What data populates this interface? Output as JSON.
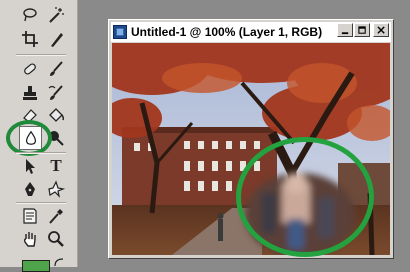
{
  "document": {
    "title": "Untitled-1 @ 100% (Layer 1, RGB)",
    "buttons": {
      "minimize": "minimize",
      "maximize": "maximize",
      "close": "close"
    }
  },
  "toolbox": {
    "tools": [
      "lasso-icon",
      "magic-wand-icon",
      "crop-icon",
      "slice-icon",
      "healing-brush-icon",
      "brush-icon",
      "clone-stamp-icon",
      "history-brush-icon",
      "eraser-icon",
      "paint-bucket-icon",
      "blur-icon",
      "dodge-icon",
      "path-select-icon",
      "type-icon",
      "pen-icon",
      "custom-shape-icon",
      "notes-icon",
      "eyedropper-icon",
      "hand-icon",
      "zoom-icon"
    ],
    "selected_tool": "blur-icon",
    "type_tool_glyph": "T",
    "foreground_color": "#4fa34a"
  },
  "annotations": {
    "highlight_color": "#23a23f"
  }
}
